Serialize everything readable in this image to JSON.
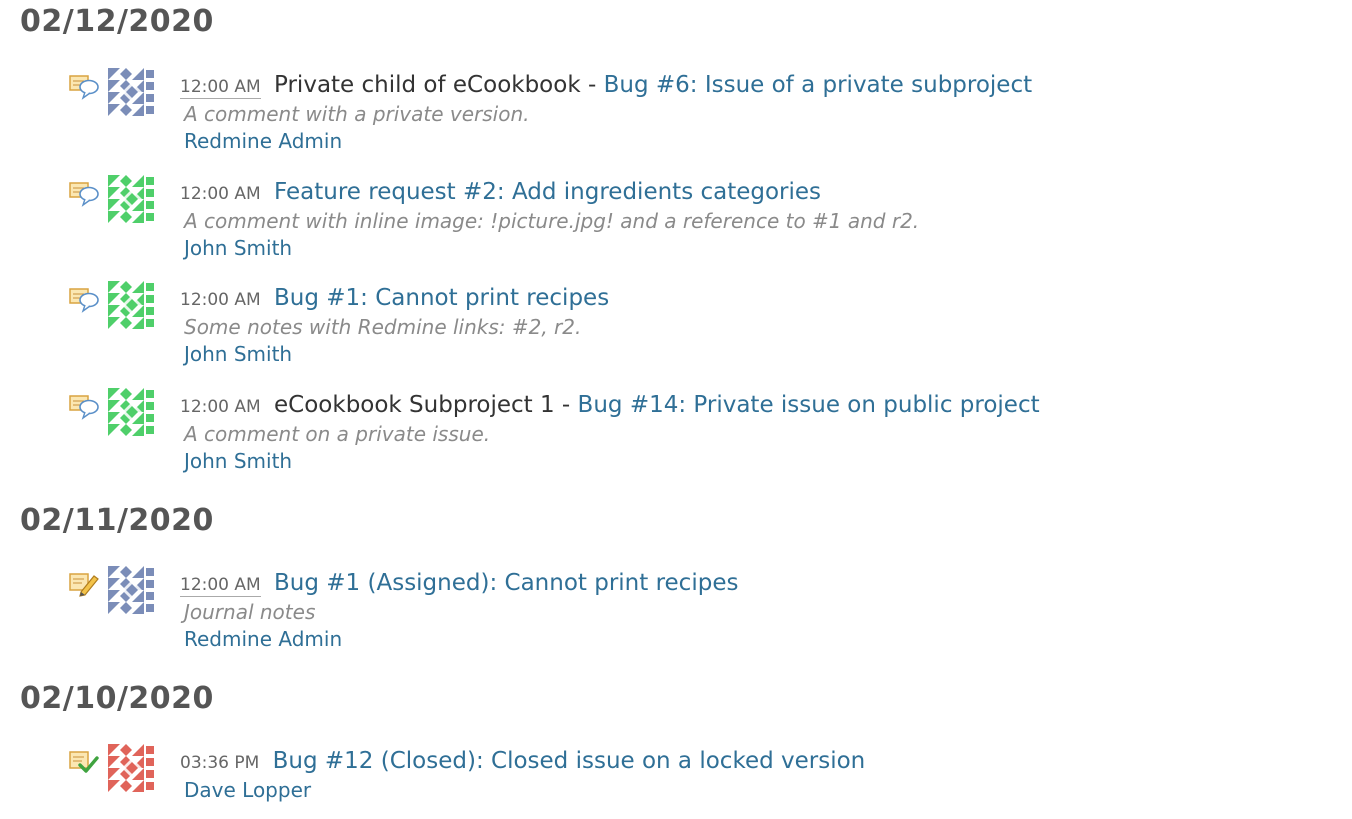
{
  "days": [
    {
      "date": "02/12/2020",
      "events": [
        {
          "icon": "comment-icon",
          "avatar_color": "#7b8db8",
          "time": "12:00 AM",
          "time_abbr": true,
          "project": "Private child of eCookbook",
          "separator": "-",
          "title": "Bug #6: Issue of a private subproject",
          "description": "A comment with a private version.",
          "author": "Redmine Admin"
        },
        {
          "icon": "comment-icon",
          "avatar_color": "#4fcf6a",
          "time": "12:00 AM",
          "time_abbr": false,
          "project": "",
          "separator": "",
          "title": "Feature request #2: Add ingredients categories",
          "description": "A comment with inline image: !picture.jpg! and a reference to #1 and r2.",
          "author": "John Smith"
        },
        {
          "icon": "comment-icon",
          "avatar_color": "#4fcf6a",
          "time": "12:00 AM",
          "time_abbr": false,
          "project": "",
          "separator": "",
          "title": "Bug #1: Cannot print recipes",
          "description": "Some notes with Redmine links: #2, r2.",
          "author": "John Smith"
        },
        {
          "icon": "comment-icon",
          "avatar_color": "#4fcf6a",
          "time": "12:00 AM",
          "time_abbr": false,
          "project": "eCookbook Subproject 1",
          "separator": "-",
          "title": "Bug #14: Private issue on public project",
          "description": "A comment on a private issue.",
          "author": "John Smith"
        }
      ]
    },
    {
      "date": "02/11/2020",
      "events": [
        {
          "icon": "edit-note-icon",
          "avatar_color": "#7b8db8",
          "time": "12:00 AM",
          "time_abbr": true,
          "project": "",
          "separator": "",
          "title": "Bug #1 (Assigned): Cannot print recipes",
          "description": "Journal notes",
          "author": "Redmine Admin"
        }
      ]
    },
    {
      "date": "02/10/2020",
      "events": [
        {
          "icon": "issue-closed-icon",
          "avatar_color": "#e0645a",
          "time": "03:36 PM",
          "time_abbr": false,
          "project": "",
          "separator": "",
          "title": "Bug #12 (Closed): Closed issue on a locked version",
          "description": "",
          "author": "Dave Lopper"
        }
      ]
    }
  ],
  "colors": {
    "link": "#2f6f96",
    "heading": "#555555",
    "description": "#8a8a8a"
  }
}
